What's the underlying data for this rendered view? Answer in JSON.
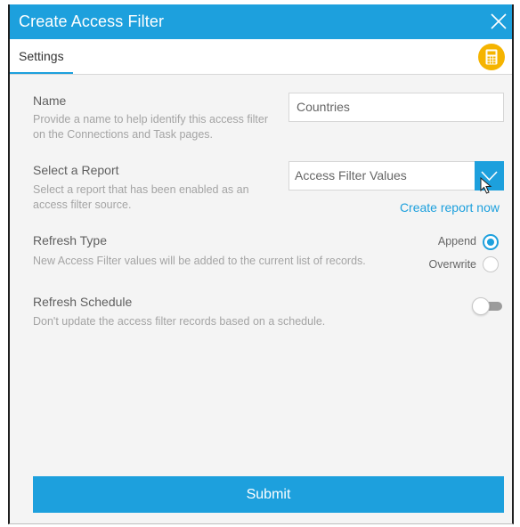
{
  "dialog": {
    "title": "Create Access Filter",
    "tab_settings": "Settings"
  },
  "name_field": {
    "label": "Name",
    "description": "Provide a name to help identify this access filter on the Connections and Task pages.",
    "value": "Countries"
  },
  "report_field": {
    "label": "Select a Report",
    "description": "Select a report that has been enabled as an access filter source.",
    "selected": "Access Filter Values",
    "create_link": "Create report now"
  },
  "refresh_type": {
    "label": "Refresh Type",
    "description": "New Access Filter values will be added to the current list of records.",
    "options": [
      "Append",
      "Overwrite"
    ],
    "selected": "Append"
  },
  "refresh_schedule": {
    "label": "Refresh Schedule",
    "description": "Don't update the access filter records based on a schedule.",
    "enabled": false
  },
  "submit_label": "Submit",
  "colors": {
    "accent": "#1da0dd",
    "calc_button": "#f5b400"
  },
  "icons": {
    "close": "close-icon",
    "calculator": "calculator-icon",
    "dropdown": "chevron-down-icon",
    "pointer": "mouse-pointer-icon"
  }
}
